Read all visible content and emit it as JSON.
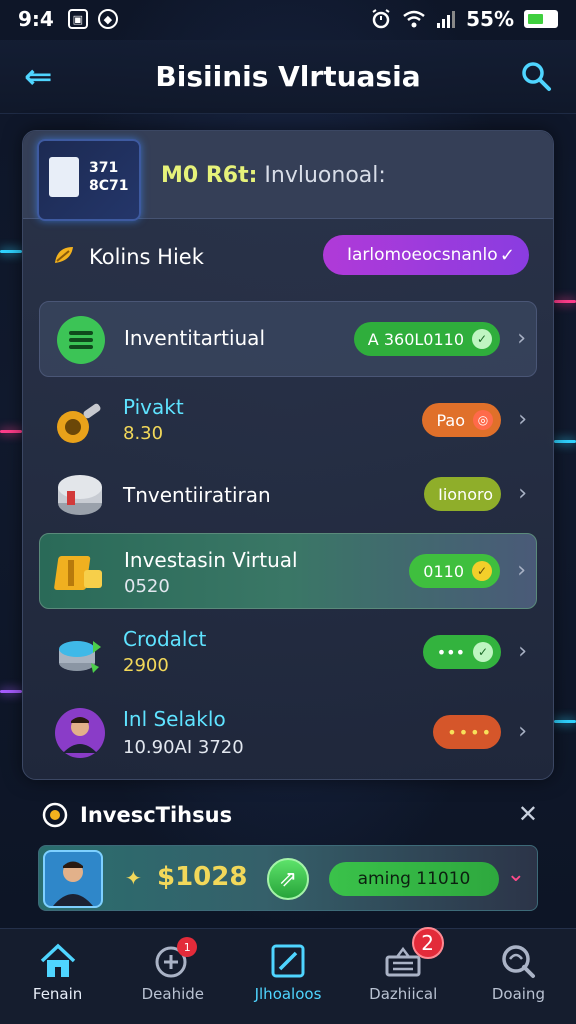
{
  "status_bar": {
    "time": "9:4",
    "battery": "55%",
    "battery_level": 0.55,
    "icons": [
      "photo-icon",
      "shield-icon",
      "alarm-icon",
      "wifi-icon",
      "signal-icon"
    ]
  },
  "header": {
    "title": "Bisiinis Vlrtuasia",
    "back_icon": "back-arrow-icon",
    "search_icon": "search-icon"
  },
  "card": {
    "logo_text": "371\n8C71",
    "subtitle_accent": "M0 R6t:",
    "subtitle_rest": "Invluonoal:",
    "section": {
      "label": "Kolins Hiek",
      "select_value": "Iarlomoeocsnanlo"
    },
    "rows": [
      {
        "name": "Inventitartiual",
        "value": "",
        "badge": "A 360L0110",
        "badge_color": "#2fae3c"
      },
      {
        "name": "Pivakt",
        "value": "8.30",
        "badge": "Pao",
        "badge_color": "#e0702a"
      },
      {
        "name": "Tnventiiratiran",
        "value": "",
        "badge": "Iionoro",
        "badge_color": "#8fae2a"
      },
      {
        "name": "Investasin Virtual",
        "value": "0520",
        "badge": "0110",
        "badge_color": "#3fbf3e"
      },
      {
        "name": "Crodalct",
        "value": "2900",
        "badge": "•••",
        "badge_color": "#33b33e"
      },
      {
        "name": "Inl Selaklo",
        "value": "10.90AI 3720",
        "badge": "••••",
        "badge_color": "#d5562a"
      }
    ]
  },
  "bottom": {
    "title": "InvescTihsus",
    "price": "$1028",
    "status": "aming 11010",
    "close_icon": "close-icon"
  },
  "tabs": [
    {
      "label": "Fenain",
      "icon": "home-icon",
      "badge": ""
    },
    {
      "label": "Deahide",
      "icon": "add-circle-icon",
      "badge": ""
    },
    {
      "label": "Jlhoaloos",
      "icon": "edit-square-icon",
      "badge": ""
    },
    {
      "label": "Dazhiical",
      "icon": "inbox-icon",
      "badge": "2"
    },
    {
      "label": "Doaing",
      "icon": "search-circle-icon",
      "badge": ""
    }
  ]
}
